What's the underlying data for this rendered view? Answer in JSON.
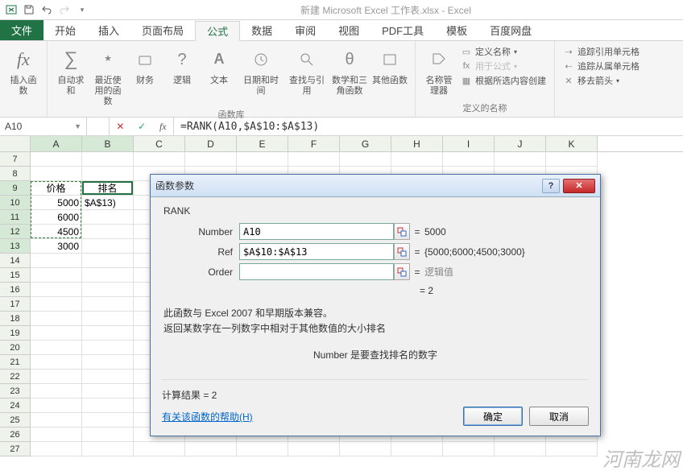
{
  "app": {
    "title": "新建 Microsoft Excel 工作表.xlsx - Excel"
  },
  "tabs": {
    "file": "文件",
    "home": "开始",
    "insert": "插入",
    "layout": "页面布局",
    "formulas": "公式",
    "data": "数据",
    "review": "审阅",
    "view": "视图",
    "pdf": "PDF工具",
    "template": "模板",
    "baidu": "百度网盘"
  },
  "ribbon": {
    "insert_fn": "插入函数",
    "autosum": "自动求和",
    "recent": "最近使用的函数",
    "financial": "财务",
    "logical": "逻辑",
    "text": "文本",
    "datetime": "日期和时间",
    "lookup": "查找与引用",
    "math": "数学和三角函数",
    "more": "其他函数",
    "lib_label": "函数库",
    "name_mgr": "名称管理器",
    "define_name": "定义名称",
    "use_in_formula": "用于公式",
    "create_from_sel": "根据所选内容创建",
    "defined_names_label": "定义的名称",
    "trace_precedents": "追踪引用单元格",
    "trace_dependents": "追踪从属单元格",
    "remove_arrows": "移去箭头"
  },
  "namebox": "A10",
  "formula": "=RANK(A10,$A$10:$A$13)",
  "columns": [
    "A",
    "B",
    "C",
    "D",
    "E",
    "F",
    "G",
    "H",
    "I",
    "J",
    "K"
  ],
  "row_nums": [
    "7",
    "8",
    "9",
    "10",
    "11",
    "12",
    "13",
    "14",
    "15",
    "16",
    "17",
    "18",
    "19",
    "20",
    "21",
    "22",
    "23",
    "24",
    "25",
    "26",
    "27"
  ],
  "cells": {
    "A9": "价格",
    "B9": "排名",
    "A10": "5000",
    "B10": "$A$13)",
    "A11": "6000",
    "A12": "4500",
    "A13": "3000"
  },
  "dialog": {
    "title": "函数参数",
    "fn": "RANK",
    "args": {
      "number_label": "Number",
      "number_val": "A10",
      "number_res": "5000",
      "ref_label": "Ref",
      "ref_val": "$A$10:$A$13",
      "ref_res": "{5000;6000;4500;3000}",
      "order_label": "Order",
      "order_val": "",
      "order_res": "逻辑值"
    },
    "eq_result": "=  2",
    "desc1": "此函数与 Excel 2007 和早期版本兼容。",
    "desc2": "返回某数字在一列数字中相对于其他数值的大小排名",
    "param_desc": "Number   是要查找排名的数字",
    "calc_result": "计算结果 =  2",
    "help_link": "有关该函数的帮助(H)",
    "ok": "确定",
    "cancel": "取消"
  },
  "watermark": "河南龙网"
}
